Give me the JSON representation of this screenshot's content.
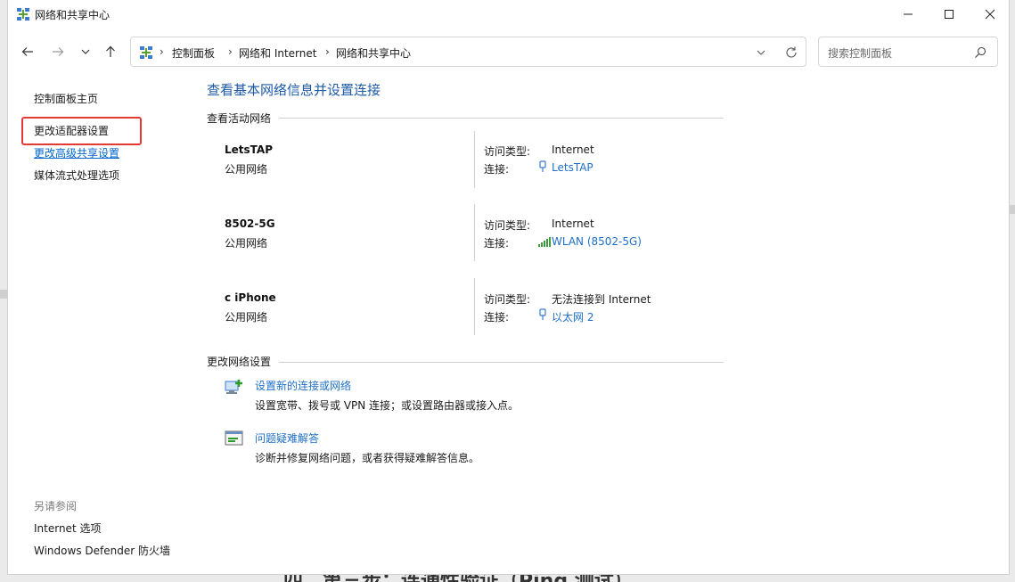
{
  "window": {
    "title": "网络和共享中心",
    "icon": "network-icon"
  },
  "nav": {
    "breadcrumbs": [
      "控制面板",
      "网络和 Internet",
      "网络和共享中心"
    ],
    "search_placeholder": "搜索控制面板"
  },
  "sidebar": {
    "links": [
      "控制面板主页",
      "更改适配器设置",
      "更改高级共享设置",
      "媒体流式处理选项"
    ],
    "see_also_label": "另请参阅",
    "see_also": [
      "Internet 选项",
      "Windows Defender 防火墙"
    ]
  },
  "main": {
    "title": "查看基本网络信息并设置连接",
    "active_networks_label": "查看活动网络",
    "networks": [
      {
        "name": "LetsTAP",
        "type": "公用网络",
        "access_key": "访问类型:",
        "access_value": "Internet",
        "conn_key": "连接:",
        "conn_value": "LetsTAP",
        "conn_icon": "ethernet-icon"
      },
      {
        "name": "8502-5G",
        "type": "公用网络",
        "access_key": "访问类型:",
        "access_value": "Internet",
        "conn_key": "连接:",
        "conn_value": "WLAN (8502-5G)",
        "conn_icon": "wifi-signal-icon"
      },
      {
        "name": "c iPhone",
        "type": "公用网络",
        "access_key": "访问类型:",
        "access_value": "无法连接到 Internet",
        "conn_key": "连接:",
        "conn_value": "以太网 2",
        "conn_icon": "ethernet-icon"
      }
    ],
    "change_settings_label": "更改网络设置",
    "tasks": [
      {
        "link": "设置新的连接或网络",
        "desc": "设置宽带、拨号或 VPN 连接；或设置路由器或接入点。",
        "icon": "new-connection-icon"
      },
      {
        "link": "问题疑难解答",
        "desc": "诊断并修复网络问题，或者获得疑难解答信息。",
        "icon": "troubleshoot-icon"
      }
    ]
  },
  "background": {
    "text": "四、第三步：连通性验证（Ping 测试）"
  },
  "colors": {
    "link": "#1e6fc8",
    "title": "#1e5aa8",
    "highlight": "#e53935"
  }
}
